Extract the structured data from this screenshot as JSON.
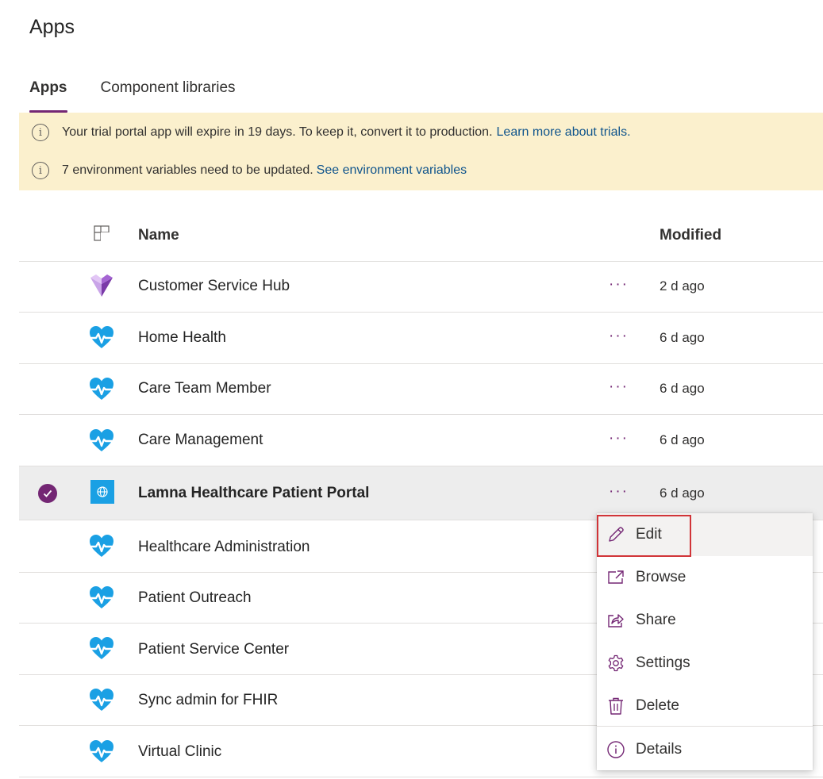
{
  "page_title": "Apps",
  "tabs": [
    {
      "label": "Apps",
      "active": true
    },
    {
      "label": "Component libraries",
      "active": false
    }
  ],
  "banner": {
    "trial_text": "Your trial portal app will expire in 19 days. To keep it, convert it to production.",
    "trial_link": "Learn more about trials.",
    "env_text": "7 environment variables need to be updated.",
    "env_link": "See environment variables",
    "info_glyph": "i"
  },
  "table": {
    "headers": {
      "name": "Name",
      "modified": "Modified"
    },
    "more_glyph": "···",
    "rows": [
      {
        "name": "Customer Service Hub",
        "modified": "2 d ago",
        "icon": "customer-service-hub-icon"
      },
      {
        "name": "Home Health",
        "modified": "6 d ago",
        "icon": "healthcare-heart-icon"
      },
      {
        "name": "Care Team Member",
        "modified": "6 d ago",
        "icon": "healthcare-heart-icon"
      },
      {
        "name": "Care Management",
        "modified": "6 d ago",
        "icon": "healthcare-heart-icon"
      },
      {
        "name": "Lamna Healthcare Patient Portal",
        "modified": "6 d ago",
        "icon": "portal-globe-icon",
        "selected": true
      },
      {
        "name": "Healthcare Administration",
        "icon": "healthcare-heart-icon"
      },
      {
        "name": "Patient Outreach",
        "icon": "healthcare-heart-icon"
      },
      {
        "name": "Patient Service Center",
        "icon": "healthcare-heart-icon"
      },
      {
        "name": "Sync admin for FHIR",
        "icon": "healthcare-heart-icon"
      },
      {
        "name": "Virtual Clinic",
        "icon": "healthcare-heart-icon"
      }
    ]
  },
  "context_menu": {
    "items": [
      {
        "label": "Edit",
        "icon": "pencil-icon"
      },
      {
        "label": "Browse",
        "icon": "open-external-icon"
      },
      {
        "label": "Share",
        "icon": "share-icon"
      },
      {
        "label": "Settings",
        "icon": "gear-icon"
      },
      {
        "label": "Delete",
        "icon": "trash-icon"
      },
      {
        "label": "Details",
        "icon": "info-icon"
      }
    ]
  },
  "colors": {
    "accent": "#742774",
    "banner_bg": "#fbf0cd",
    "link": "#0f548c",
    "highlight_box": "#d13438",
    "selected_row": "#ededed",
    "heart_icon": "#1aa0e4"
  }
}
